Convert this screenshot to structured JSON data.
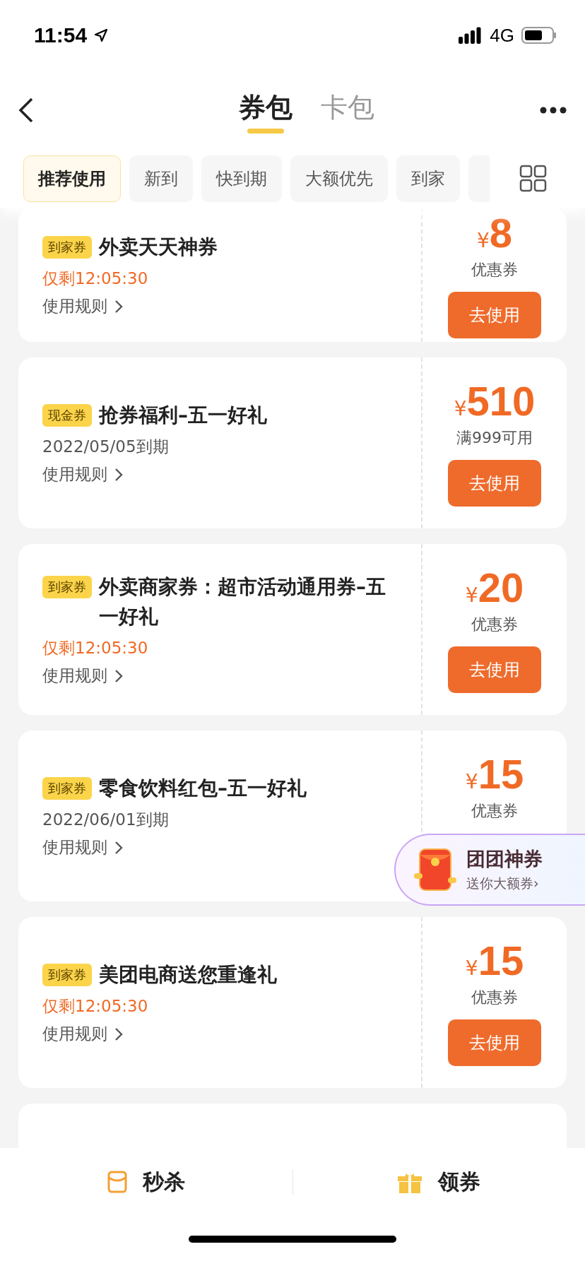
{
  "status_bar": {
    "time": "11:54",
    "network": "4G"
  },
  "nav": {
    "tabs": [
      {
        "label": "券包",
        "selected": true
      },
      {
        "label": "卡包",
        "selected": false
      }
    ]
  },
  "filters": [
    {
      "label": "推荐使用",
      "selected": true
    },
    {
      "label": "新到",
      "selected": false
    },
    {
      "label": "快到期",
      "selected": false
    },
    {
      "label": "大额优先",
      "selected": false
    },
    {
      "label": "到家",
      "selected": false
    }
  ],
  "coupons": [
    {
      "tag": "到家券",
      "title": "外卖天天神券",
      "urgent": true,
      "note": "仅剩12:05:30",
      "rules": "使用规则",
      "currency": "¥",
      "amount": "8",
      "condition": "优惠券",
      "button": "去使用"
    },
    {
      "tag": "现金券",
      "title": "抢券福利–五一好礼",
      "urgent": false,
      "note": "2022/05/05到期",
      "rules": "使用规则",
      "currency": "¥",
      "amount": "510",
      "condition": "满999可用",
      "button": "去使用"
    },
    {
      "tag": "到家券",
      "title": "外卖商家券：超市活动通用券–五一好礼",
      "urgent": true,
      "note": "仅剩12:05:30",
      "rules": "使用规则",
      "currency": "¥",
      "amount": "20",
      "condition": "优惠券",
      "button": "去使用"
    },
    {
      "tag": "到家券",
      "title": "零食饮料红包–五一好礼",
      "urgent": false,
      "note": "2022/06/01到期",
      "rules": "使用规则",
      "currency": "¥",
      "amount": "15",
      "condition": "优惠券"
    },
    {
      "tag": "到家券",
      "title": "美团电商送您重逢礼",
      "urgent": true,
      "note": "仅剩12:05:30",
      "rules": "使用规则",
      "currency": "¥",
      "amount": "15",
      "condition": "优惠券",
      "button": "去使用"
    }
  ],
  "promo": {
    "title": "团团神券",
    "subtitle": "送你大额券›"
  },
  "bottom_bar": [
    {
      "kind": "flash",
      "label": "秒杀"
    },
    {
      "kind": "gift",
      "label": "领券"
    }
  ]
}
